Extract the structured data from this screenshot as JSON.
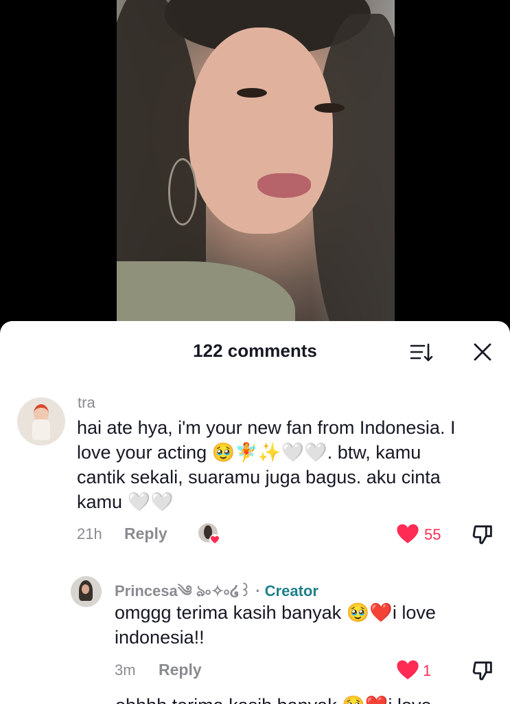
{
  "header": {
    "comment_count_label": "122 comments"
  },
  "icons": {
    "sort": "sort-icon",
    "close": "close-icon",
    "like": "heart-icon",
    "dislike": "thumbs-down-icon"
  },
  "colors": {
    "like_red": "#fe2c55",
    "creator_teal": "#1f7f8a",
    "muted_gray": "#8a8b91"
  },
  "comments": [
    {
      "username": "tra",
      "text_lines": [
        "hai ate hya, i'm your new fan from Indonesia. I",
        "love your acting 🥹🧚✨🤍🤍. btw, kamu",
        "cantik sekali, suaramu juga bagus. aku cinta",
        "kamu 🤍🤍"
      ],
      "time": "21h",
      "reply_label": "Reply",
      "likes": "55"
    }
  ],
  "replies": [
    {
      "username": "Princesa༄ ঌ৹✧৹໒꒱",
      "dot": " · ",
      "creator_label": "Creator",
      "text_lines": [
        "omggg terima kasih banyak 🥹❤️i love",
        "indonesia!!"
      ],
      "time": "3m",
      "reply_label": "Reply",
      "likes": "1"
    }
  ],
  "partial_next": "ohhhh terima kasih banyak 🥹❤️i love"
}
